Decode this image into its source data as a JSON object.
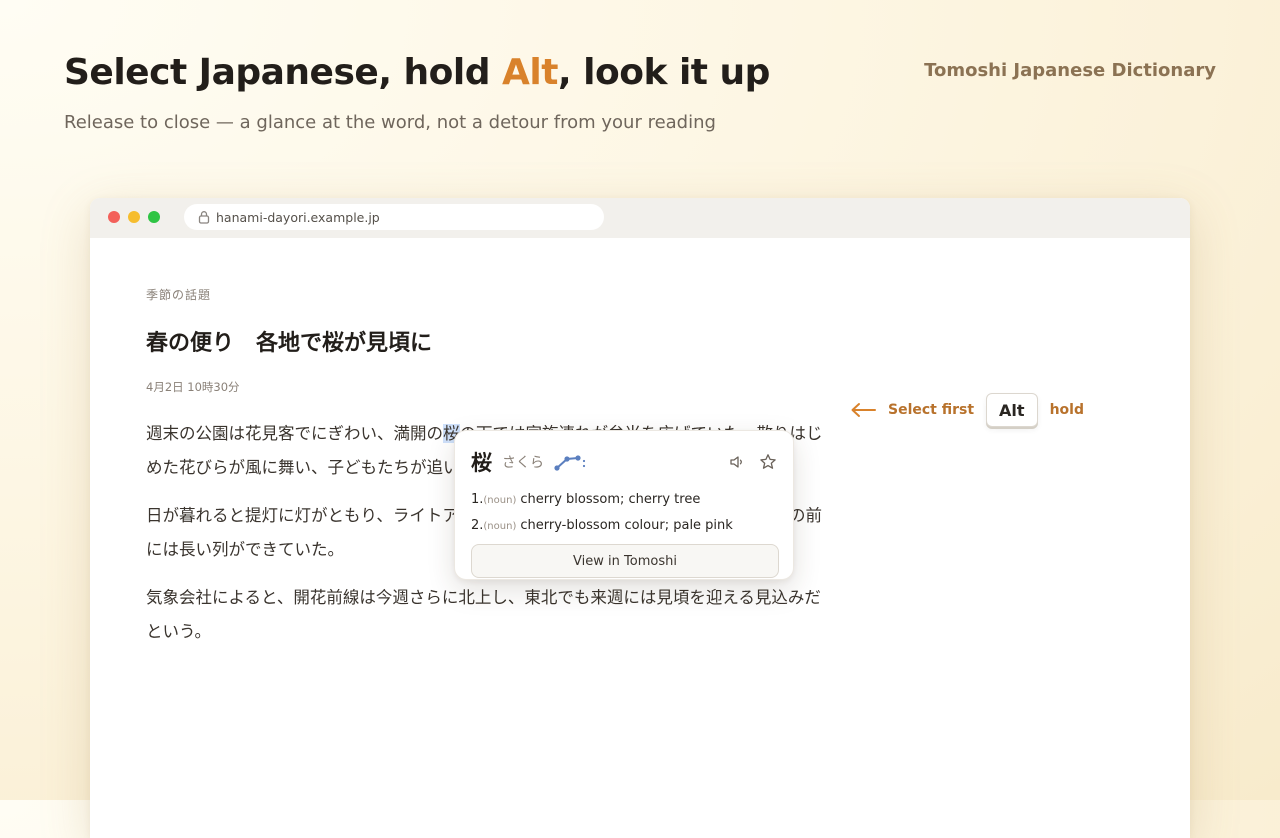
{
  "hero": {
    "title_pre": "Select Japanese, hold ",
    "title_key": "Alt",
    "title_post": ", look it up",
    "subtitle": "Release to close — a glance at the word, not a detour from your reading",
    "brand": "Tomoshi Japanese Dictionary"
  },
  "browser": {
    "url": "hanami-dayori.example.jp"
  },
  "article": {
    "category": "季節の話題",
    "title": "春の便り　各地で桜が見頃に",
    "date": "4月2日 10時30分",
    "p1_before": "週末の公園は花見客でにぎわい、満開の",
    "p1_selected": "桜",
    "p1_after": "の下では家族連れが弁当を広げていた。散りはじめた花びらが風に舞い、子どもたちが追いかけていた。",
    "p2": "日が暮れると提灯に灯がともり、ライトアップされた並木道には多くの人が訪れ、屋台の前には長い列ができていた。",
    "p3": "気象会社によると、開花前線は今週さらに北上し、東北でも来週には見頃を迎える見込みだという。"
  },
  "hint": {
    "select_first": "Select first",
    "key": "Alt",
    "hold": "hold",
    "arrow_icon": "arrow-left-icon"
  },
  "popup": {
    "word": "桜",
    "reading": "さくら",
    "pitch_icon": "pitch-accent-icon",
    "audio_icon": "speaker-icon",
    "star_icon": "star-icon",
    "senses": [
      {
        "num": "1.",
        "pos": "(noun)",
        "gloss": "cherry blossom; cherry tree"
      },
      {
        "num": "2.",
        "pos": "(noun)",
        "gloss": "cherry-blossom colour; pale pink"
      }
    ],
    "view_button": "View in Tomoshi"
  },
  "colors": {
    "accent": "#d9822b",
    "hint": "#b8722c",
    "brand": "#8b7253",
    "selection": "#cfe1fb",
    "pitch": "#5b7fbf"
  }
}
